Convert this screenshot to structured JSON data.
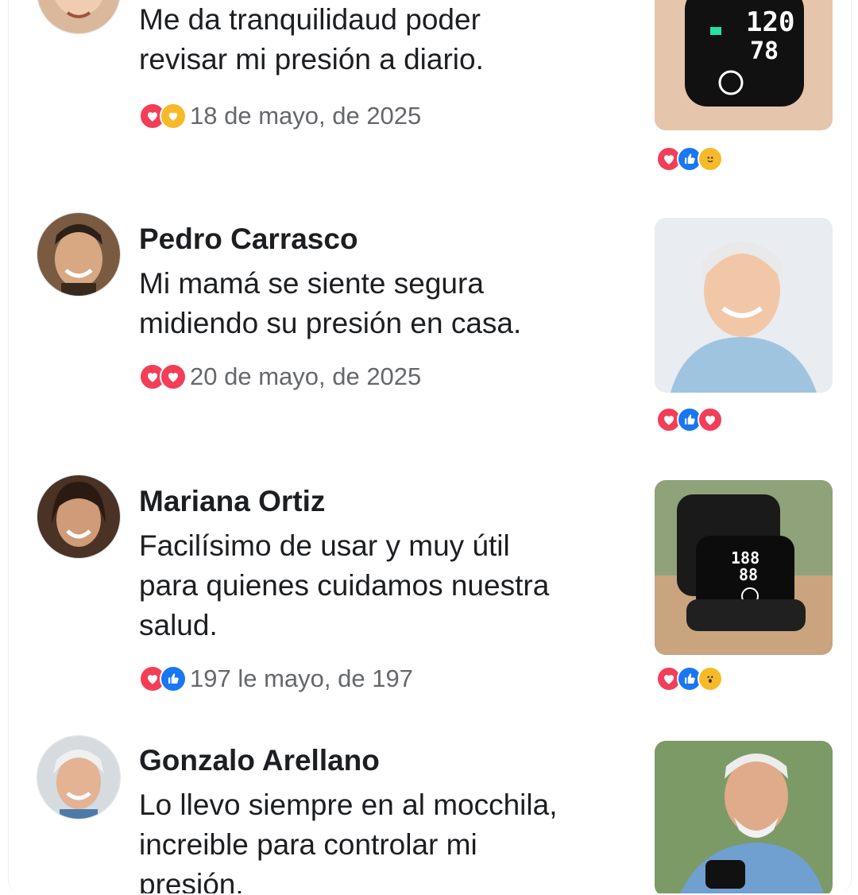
{
  "posts": [
    {
      "name": "",
      "text_parts": [
        "Me da tranquilidaud poder",
        "revisar mi presión a diario."
      ],
      "date": "18 de mayo, de 2025",
      "reactions": [
        "love-icon",
        "care-icon"
      ],
      "image_reactions": [
        "love-icon",
        "like-icon",
        "care-icon"
      ],
      "image": "blood-pressure-monitor-wrist-photo"
    },
    {
      "name": "Pedro Carrasco",
      "text_parts": [
        "Mi mamá se siente segura",
        "midiendo su presión en casa."
      ],
      "date": "20 de mayo, de 2025",
      "reactions": [
        "love-icon",
        "love-icon"
      ],
      "image_reactions": [
        "love-icon",
        "like-icon",
        "love-icon"
      ],
      "image": "smiling-elderly-woman-photo"
    },
    {
      "name": "Mariana Ortiz",
      "text_parts": [
        "Facilísimo de usar y muy útil",
        "para quienes cuidamos nuestra",
        "salud."
      ],
      "date": "197 le mayo, de 197",
      "reactions": [
        "love-icon",
        "like-icon"
      ],
      "image_reactions": [
        "love-icon",
        "like-icon",
        "wow-icon"
      ],
      "image": "monitor-in-case-photo"
    },
    {
      "name": "Gonzalo Arellano",
      "text_parts": [
        "Lo llevo siempre en al mocchila,",
        "increible para controlar mi",
        "presión."
      ],
      "date": "",
      "reactions": [],
      "image_reactions": [],
      "image": "elderly-man-wearing-monitor-photo"
    }
  ],
  "colors": {
    "love": "#f33e58",
    "like": "#1877f2",
    "care": "#f7b928",
    "highlight": "#e7f0fc",
    "date_text": "#65676b"
  }
}
